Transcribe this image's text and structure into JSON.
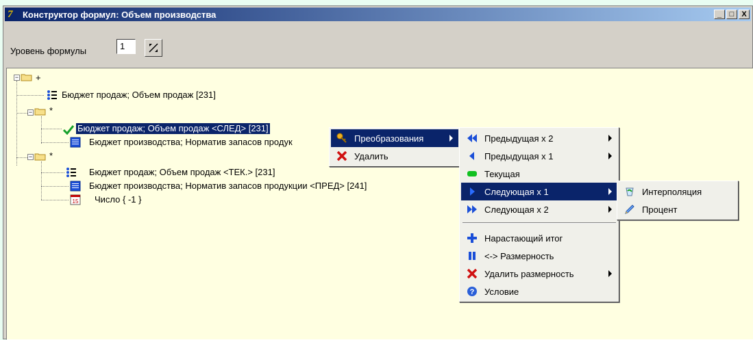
{
  "window": {
    "title": "Конструктор формул: Объем производства",
    "minimize_glyph": "_",
    "maximize_glyph": "□",
    "close_glyph": "X"
  },
  "toolbar": {
    "level_label": "Уровень формулы",
    "level_value": "1"
  },
  "tree": {
    "root_label": "+",
    "item_1": "Бюджет продаж;  Объем продаж   [231]",
    "group_1": "*",
    "item_2": "Бюджет продаж;  Объем продаж   <СЛЕД>  [231]",
    "item_3": "Бюджет производства;  Норматив запасов продук",
    "group_2": "*",
    "item_4": "Бюджет продаж;  Объем продаж   <ТЕК.>  [231]",
    "item_5": "Бюджет производства;  Норматив запасов продукции   <ПРЕД>  [241]",
    "item_6": "Число { -1 }",
    "item_6_icon_text": "15"
  },
  "context_menu": {
    "transforms": "Преобразования",
    "delete": "Удалить"
  },
  "submenu": {
    "prev2": "Предыдущая х 2",
    "prev1": "Предыдущая х 1",
    "current": "Текущая",
    "next1": "Следующая х 1",
    "next2": "Следующая х 2",
    "running_total": "Нарастающий итог",
    "dimension": "<-> Размерность",
    "delete_dimension": "Удалить размерность",
    "condition": "Условие"
  },
  "subsubmenu": {
    "interpolation": "Интерполяция",
    "percent": "Процент"
  },
  "colors": {
    "selection": "#0a246a",
    "panel_bg": "#ffffe1",
    "desktop_bg": "#e9fdf2"
  }
}
